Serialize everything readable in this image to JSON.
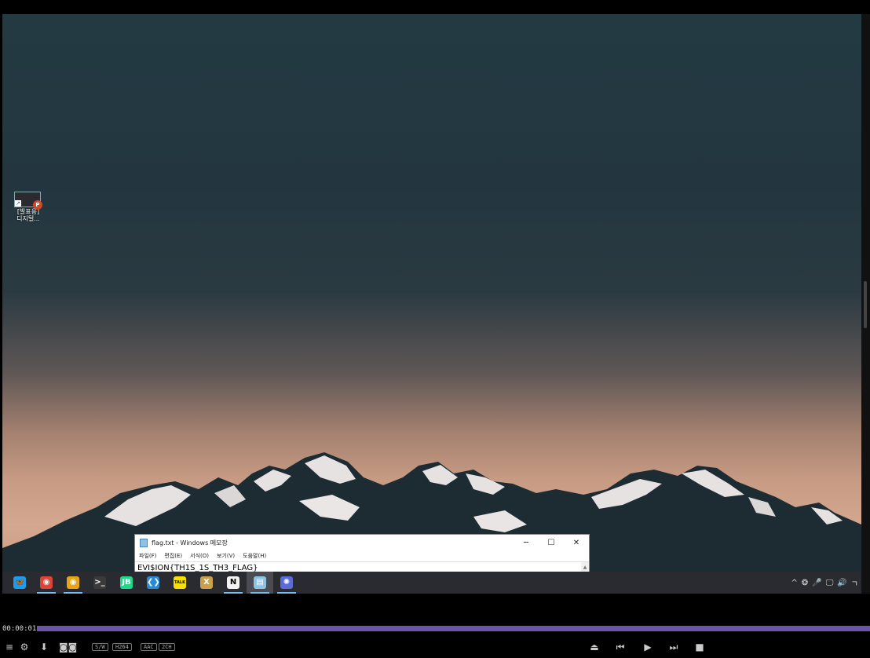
{
  "desktop": {
    "icon_label_line1": "[발표용]",
    "icon_label_line2": "디지털...",
    "icon_badge": "P"
  },
  "notepad": {
    "title": "flag.txt - Windows 메모장",
    "minimize": "─",
    "maximize": "☐",
    "close": "✕",
    "menu": [
      "파일(F)",
      "편집(E)",
      "서식(O)",
      "보기(V)",
      "도움말(H)"
    ],
    "content": "EVI$ION{TH1S_1S_TH3_FLAG}"
  },
  "taskbar": {
    "apps": [
      {
        "name": "bluesky-app",
        "glyph": "🦋",
        "color": "#1d9bf0",
        "open": false,
        "active": false
      },
      {
        "name": "chrome-app",
        "glyph": "◉",
        "color": "#db4437",
        "open": true,
        "active": false
      },
      {
        "name": "chrome-canary-app",
        "glyph": "◉",
        "color": "#e8a317",
        "open": true,
        "active": false
      },
      {
        "name": "terminal-app",
        "glyph": ">_",
        "color": "#3a3a3a",
        "open": false,
        "active": false
      },
      {
        "name": "jetbrains-app",
        "glyph": "JB",
        "color": "#21d789",
        "open": false,
        "active": false
      },
      {
        "name": "vscode-app",
        "glyph": "❮❯",
        "color": "#2a8ad4",
        "open": false,
        "active": false
      },
      {
        "name": "kakaotalk-app",
        "glyph": "TALK",
        "color": "#f9e000",
        "open": false,
        "active": false
      },
      {
        "name": "hwp-app",
        "glyph": "X",
        "color": "#c8a050",
        "open": false,
        "active": false
      },
      {
        "name": "notion-app",
        "glyph": "N",
        "color": "#f2f2f2",
        "open": true,
        "active": false
      },
      {
        "name": "notepad-app",
        "glyph": "▤",
        "color": "#8fc3e6",
        "open": true,
        "active": true
      },
      {
        "name": "davinci-app",
        "glyph": "✺",
        "color": "#5a6ad6",
        "open": true,
        "active": false
      }
    ],
    "tray": [
      "^",
      "❂",
      "🎤",
      "🖵",
      "🔊",
      "ㄱ"
    ]
  },
  "player": {
    "time": "00:00:01",
    "progress": 1.0,
    "badges": [
      "S/W",
      "H264",
      "AAC",
      "2CH"
    ],
    "accent": "#6b54a6"
  }
}
